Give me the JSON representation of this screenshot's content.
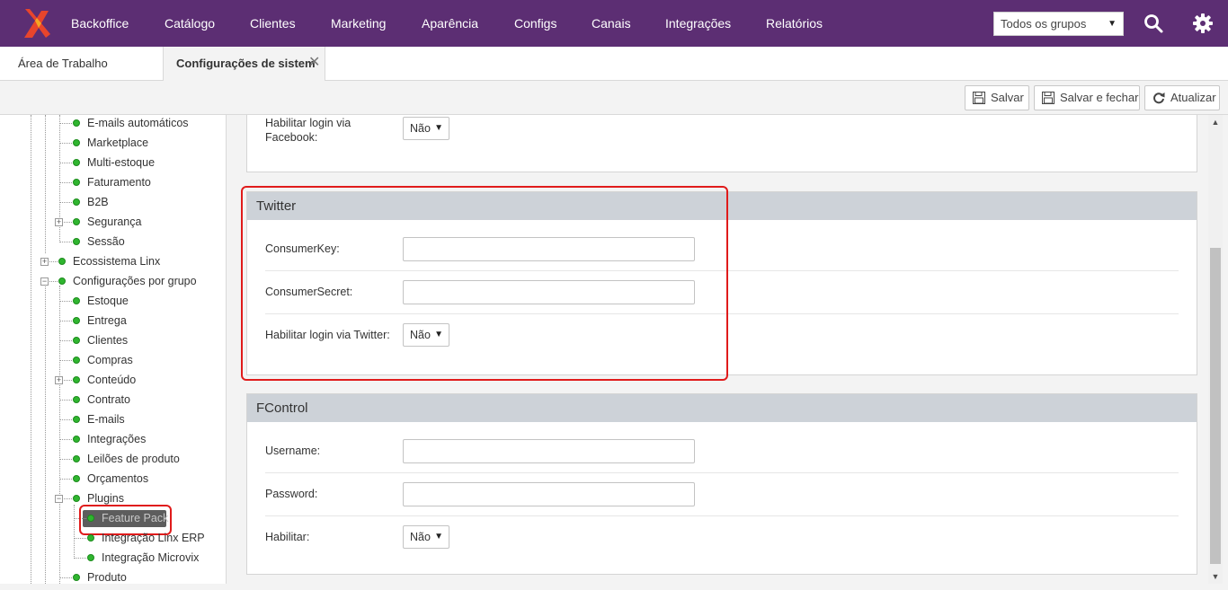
{
  "topnav": {
    "items": [
      "Backoffice",
      "Catálogo",
      "Clientes",
      "Marketing",
      "Aparência",
      "Configs",
      "Canais",
      "Integrações",
      "Relatórios"
    ],
    "group_select": "Todos os grupos",
    "brand_color": "#5c2e73"
  },
  "tabs": {
    "workspace": "Área de Trabalho",
    "active": "Configurações de sistem"
  },
  "toolbar": {
    "save": "Salvar",
    "save_close": "Salvar e fechar",
    "refresh": "Atualizar"
  },
  "tree": {
    "items": [
      "E-mails automáticos",
      "Marketplace",
      "Multi-estoque",
      "Faturamento",
      "B2B",
      "Segurança",
      "Sessão",
      "Ecossistema Linx",
      "Configurações por grupo",
      "Estoque",
      "Entrega",
      "Clientes",
      "Compras",
      "Conteúdo",
      "Contrato",
      "E-mails",
      "Integrações",
      "Leilões de produto",
      "Orçamentos",
      "Plugins",
      "Feature Pack",
      "Integração Linx ERP",
      "Integração Microvix",
      "Produto"
    ]
  },
  "facebook": {
    "login_label_1": "Habilitar login via",
    "login_label_2": "Facebook:",
    "login_value": "Não"
  },
  "twitter": {
    "title": "Twitter",
    "consumer_key_label": "ConsumerKey:",
    "consumer_key_value": "",
    "consumer_secret_label": "ConsumerSecret:",
    "consumer_secret_value": "",
    "login_label": "Habilitar login via Twitter:",
    "login_value": "Não"
  },
  "fcontrol": {
    "title": "FControl",
    "username_label": "Username:",
    "username_value": "",
    "password_label": "Password:",
    "password_value": "",
    "enable_label": "Habilitar:",
    "enable_value": "Não"
  },
  "colors": {
    "highlight": "#e01b1b",
    "status_dot": "#2fb52f",
    "panel_header": "#cdd2d8"
  }
}
